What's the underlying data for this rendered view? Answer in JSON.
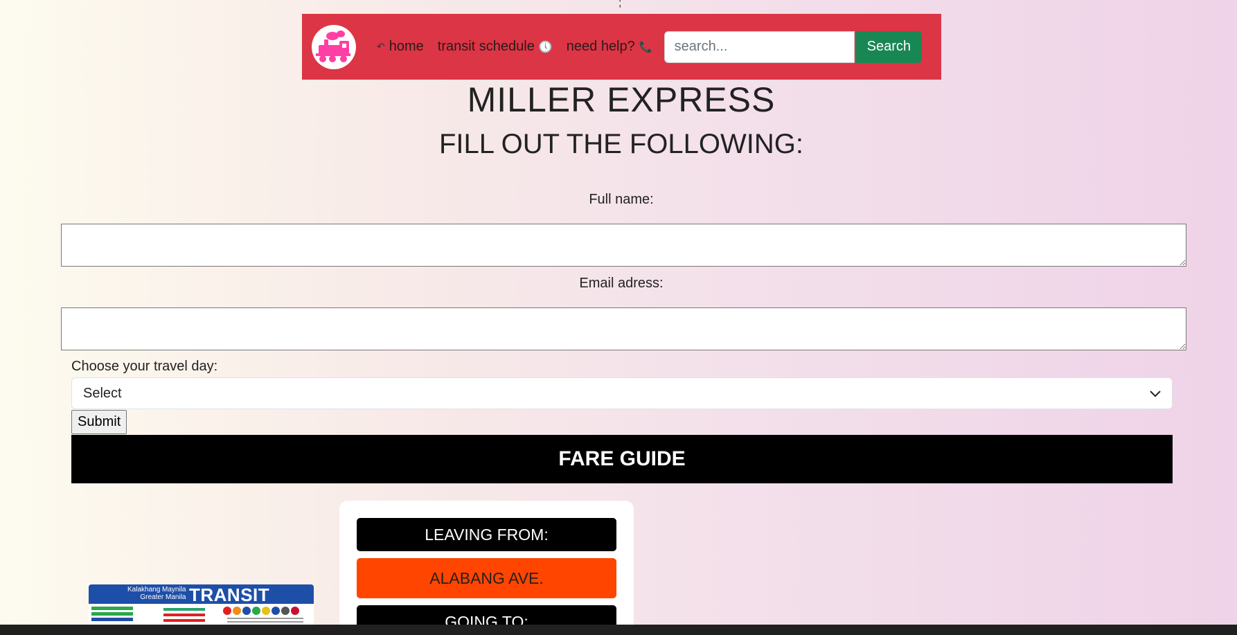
{
  "stray_text": ";",
  "nav": {
    "home_label": "home",
    "schedule_label": "transit schedule",
    "help_label": "need help?",
    "search_placeholder": "search...",
    "search_button": "Search",
    "home_icon": "↶",
    "clock_icon": "🕔",
    "phone_icon": "📞"
  },
  "header": {
    "title": "MILLER EXPRESS",
    "subtitle": "FILL OUT THE FOLLOWING:"
  },
  "form": {
    "full_name_label": "Full name:",
    "email_label": "Email adress:",
    "travel_day_label": "Choose your travel day:",
    "travel_day_selected": "Select",
    "submit_label": "Submit"
  },
  "fare_guide": {
    "heading": "FARE GUIDE",
    "leaving_label": "LEAVING FROM:",
    "leaving_value": "ALABANG AVE.",
    "going_label": "GOING TO:"
  },
  "map": {
    "small_line1": "Kalakhang Maynila",
    "small_line2": "Greater Manila",
    "big_title": "TRANSIT MAP"
  },
  "colors": {
    "navbar": "#dc3545",
    "search_button": "#198754",
    "fare_guide_bg": "#000000",
    "leaving_value_bg": "#ff4500",
    "logo_accent": "#ff3fa4"
  }
}
